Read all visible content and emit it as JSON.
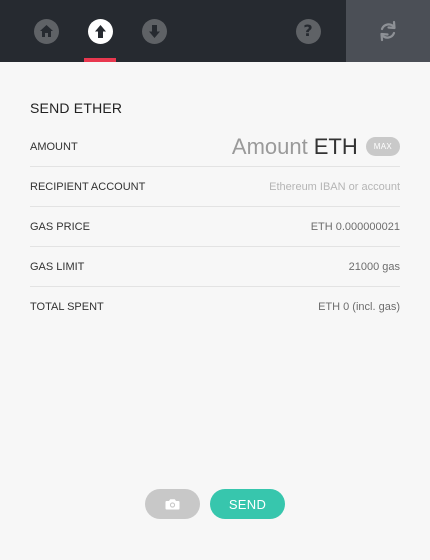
{
  "nav": {
    "items": [
      {
        "icon": "home-icon",
        "active": false
      },
      {
        "icon": "send-upload-icon",
        "active": true
      },
      {
        "icon": "receive-download-icon",
        "active": false
      },
      {
        "icon": "help-icon",
        "active": false,
        "glyph": "?"
      },
      {
        "icon": "refresh-icon",
        "active": false
      }
    ],
    "active_color": "#e8384f"
  },
  "form": {
    "title": "SEND ETHER",
    "amount": {
      "label": "AMOUNT",
      "placeholder": "Amount",
      "unit": "ETH",
      "max_label": "MAX"
    },
    "recipient": {
      "label": "RECIPIENT ACCOUNT",
      "placeholder": "Ethereum IBAN or account"
    },
    "gas_price": {
      "label": "GAS PRICE",
      "value": "ETH 0.000000021"
    },
    "gas_limit": {
      "label": "GAS LIMIT",
      "value": "21000 gas"
    },
    "total_spent": {
      "label": "TOTAL SPENT",
      "value": "ETH 0 (incl. gas)"
    }
  },
  "actions": {
    "camera_icon": "camera-icon",
    "send_label": "SEND",
    "send_color": "#37c6ad"
  }
}
